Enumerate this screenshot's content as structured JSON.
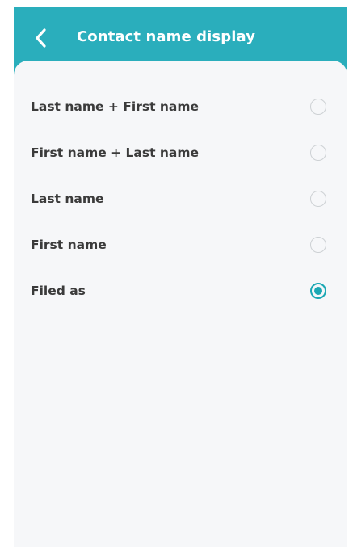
{
  "header": {
    "title": "Contact name display",
    "back_icon": "chevron-left-icon",
    "background_color": "#2aaebc"
  },
  "options": [
    {
      "label": "Last name + First name",
      "selected": false
    },
    {
      "label": "First name + Last name",
      "selected": false
    },
    {
      "label": "Last name",
      "selected": false
    },
    {
      "label": "First name",
      "selected": false
    },
    {
      "label": "Filed as",
      "selected": true
    }
  ],
  "colors": {
    "accent": "#1ba8b4",
    "text": "#3b3b3b",
    "radio_border": "#cdd1d4",
    "content_bg": "#f6f7f9"
  }
}
